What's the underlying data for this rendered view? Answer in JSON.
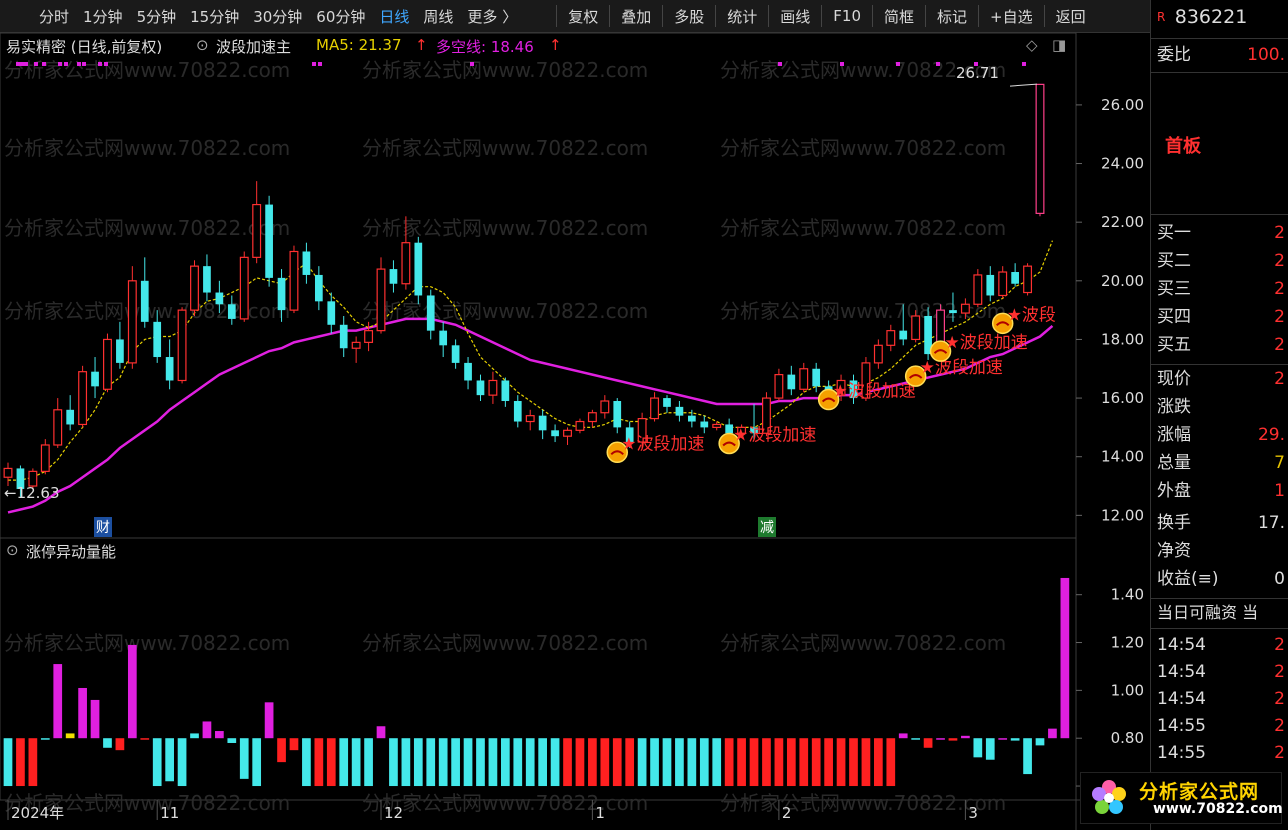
{
  "toolbar": {
    "periods": [
      "分时",
      "1分钟",
      "5分钟",
      "15分钟",
      "30分钟",
      "60分钟",
      "日线",
      "周线",
      "更多 〉"
    ],
    "active": "日线",
    "tools": [
      "复权",
      "叠加",
      "多股",
      "统计",
      "画线",
      "F10",
      "简框",
      "标记",
      "+自选",
      "返回"
    ]
  },
  "main_legend": {
    "stock": "易实精密 (日线,前复权)",
    "indicator": "波段加速主",
    "ma5_label": "MA5: 21.37",
    "ma5_arrow": "↑",
    "dk_label": "多空线: 18.46",
    "dk_arrow": "↑"
  },
  "watermark": "分析家公式网www.70822.com",
  "sub_legend": "涨停异动量能",
  "annotations": {
    "high_label": "26.71",
    "low_label": "←12.63",
    "signal_text": "★波段加速",
    "signal_text_cut": "★波段",
    "cai": "财",
    "jian": "减"
  },
  "colors": {
    "up": "#ff3030",
    "down": "#44e8ea",
    "ma5": "#e6d000",
    "dk": "#e020e0",
    "vol_pos": "#e020e0",
    "vol_neg_red": "#ff2020",
    "vol_neg_cyan": "#44e8ea",
    "vol_yellow": "#f0e000"
  },
  "right_panel": {
    "code": "836221",
    "code_tag": "R",
    "weibi": "委比",
    "weibi_val": "100.",
    "first_board": "首板",
    "bids": [
      {
        "label": "买一",
        "val": "2"
      },
      {
        "label": "买二",
        "val": "2"
      },
      {
        "label": "买三",
        "val": "2"
      },
      {
        "label": "买四",
        "val": "2"
      },
      {
        "label": "买五",
        "val": "2"
      }
    ],
    "stats": [
      {
        "label": "现价",
        "val": "2",
        "cls": ""
      },
      {
        "label": "涨跌",
        "val": "",
        "cls": ""
      },
      {
        "label": "涨幅",
        "val": "29.",
        "cls": ""
      },
      {
        "label": "总量",
        "val": "7",
        "cls": "y"
      },
      {
        "label": "外盘",
        "val": "1",
        "cls": ""
      },
      {
        "label": "换手",
        "val": "17.",
        "cls": "w"
      },
      {
        "label": "净资",
        "val": "",
        "cls": ""
      },
      {
        "label": "收益(≡)",
        "val": "0",
        "cls": "w"
      }
    ],
    "margin_title": "当日可融资 当",
    "ticks": [
      {
        "t": "14:54",
        "v": "2"
      },
      {
        "t": "14:54",
        "v": "2"
      },
      {
        "t": "14:54",
        "v": "2"
      },
      {
        "t": "14:55",
        "v": "2"
      },
      {
        "t": "14:55",
        "v": "2"
      }
    ]
  },
  "logo": {
    "name": "分析家公式网",
    "url": "www.70822.com"
  },
  "chart_data": [
    {
      "type": "candlestick",
      "title": "易实精密 (日线,前复权)",
      "y_ticks": [
        12.0,
        14.0,
        16.0,
        18.0,
        20.0,
        22.0,
        24.0,
        26.0
      ],
      "ylim": [
        11.5,
        27.6
      ],
      "x_labels": [
        {
          "label": "2024年",
          "index": 0
        },
        {
          "label": "11",
          "index": 12
        },
        {
          "label": "12",
          "index": 30
        },
        {
          "label": "1",
          "index": 47
        },
        {
          "label": "2",
          "index": 62
        },
        {
          "label": "3",
          "index": 77
        }
      ],
      "candles": [
        [
          13.3,
          13.8,
          13.0,
          13.6
        ],
        [
          13.6,
          13.7,
          12.63,
          12.9
        ],
        [
          13.0,
          13.6,
          12.9,
          13.5
        ],
        [
          13.5,
          14.6,
          13.4,
          14.4
        ],
        [
          14.4,
          16.0,
          14.3,
          15.6
        ],
        [
          15.6,
          16.1,
          14.9,
          15.1
        ],
        [
          15.1,
          17.1,
          15.0,
          16.9
        ],
        [
          16.9,
          17.4,
          16.0,
          16.4
        ],
        [
          16.3,
          18.2,
          16.2,
          18.0
        ],
        [
          18.0,
          18.6,
          17.0,
          17.2
        ],
        [
          17.2,
          20.5,
          17.0,
          20.0
        ],
        [
          20.0,
          20.8,
          18.4,
          18.6
        ],
        [
          18.6,
          19.0,
          17.2,
          17.4
        ],
        [
          17.4,
          18.0,
          16.3,
          16.6
        ],
        [
          16.6,
          19.1,
          16.5,
          19.0
        ],
        [
          19.0,
          20.7,
          18.8,
          20.5
        ],
        [
          20.5,
          20.9,
          19.3,
          19.6
        ],
        [
          19.6,
          20.0,
          18.9,
          19.2
        ],
        [
          19.2,
          19.5,
          18.5,
          18.7
        ],
        [
          18.7,
          21.0,
          18.6,
          20.8
        ],
        [
          20.8,
          23.4,
          20.6,
          22.6
        ],
        [
          22.6,
          22.9,
          19.8,
          20.1
        ],
        [
          20.1,
          20.4,
          18.6,
          19.0
        ],
        [
          19.0,
          21.2,
          18.9,
          21.0
        ],
        [
          21.0,
          21.3,
          19.9,
          20.2
        ],
        [
          20.2,
          20.5,
          19.0,
          19.3
        ],
        [
          19.3,
          19.6,
          18.2,
          18.5
        ],
        [
          18.5,
          18.8,
          17.4,
          17.7
        ],
        [
          17.7,
          18.1,
          17.2,
          17.9
        ],
        [
          17.9,
          18.6,
          17.6,
          18.3
        ],
        [
          18.3,
          20.8,
          18.2,
          20.4
        ],
        [
          20.4,
          20.7,
          19.6,
          19.9
        ],
        [
          19.9,
          22.2,
          19.7,
          21.3
        ],
        [
          21.3,
          21.5,
          19.2,
          19.5
        ],
        [
          19.5,
          19.7,
          18.0,
          18.3
        ],
        [
          18.3,
          18.6,
          17.4,
          17.8
        ],
        [
          17.8,
          18.0,
          17.0,
          17.2
        ],
        [
          17.2,
          17.4,
          16.3,
          16.6
        ],
        [
          16.6,
          16.8,
          15.9,
          16.1
        ],
        [
          16.1,
          16.9,
          15.8,
          16.6
        ],
        [
          16.6,
          16.7,
          15.7,
          15.9
        ],
        [
          15.9,
          16.1,
          15.0,
          15.2
        ],
        [
          15.2,
          15.6,
          14.9,
          15.4
        ],
        [
          15.4,
          15.6,
          14.6,
          14.9
        ],
        [
          14.9,
          15.1,
          14.5,
          14.7
        ],
        [
          14.7,
          15.0,
          14.4,
          14.9
        ],
        [
          14.9,
          15.3,
          14.8,
          15.2
        ],
        [
          15.2,
          15.6,
          15.0,
          15.5
        ],
        [
          15.5,
          16.1,
          15.3,
          15.9
        ],
        [
          15.9,
          16.0,
          14.8,
          15.0
        ],
        [
          15.0,
          15.2,
          14.3,
          14.5
        ],
        [
          14.5,
          15.5,
          14.3,
          15.3
        ],
        [
          15.3,
          16.2,
          15.2,
          16.0
        ],
        [
          16.0,
          16.1,
          15.5,
          15.7
        ],
        [
          15.7,
          15.9,
          15.2,
          15.4
        ],
        [
          15.4,
          15.6,
          15.0,
          15.2
        ],
        [
          15.2,
          15.4,
          14.8,
          15.0
        ],
        [
          15.0,
          15.2,
          14.9,
          15.1
        ],
        [
          15.1,
          15.3,
          14.7,
          14.8
        ],
        [
          14.8,
          15.1,
          14.7,
          15.0
        ],
        [
          15.0,
          15.8,
          14.6,
          14.8
        ],
        [
          14.8,
          16.2,
          14.7,
          16.0
        ],
        [
          16.0,
          17.0,
          15.9,
          16.8
        ],
        [
          16.8,
          17.1,
          16.1,
          16.3
        ],
        [
          16.3,
          17.2,
          16.2,
          17.0
        ],
        [
          17.0,
          17.2,
          16.2,
          16.4
        ],
        [
          16.4,
          16.6,
          15.9,
          16.1
        ],
        [
          16.1,
          16.8,
          15.9,
          16.6
        ],
        [
          16.6,
          16.8,
          15.8,
          16.0
        ],
        [
          16.0,
          17.4,
          15.9,
          17.2
        ],
        [
          17.2,
          18.0,
          17.0,
          17.8
        ],
        [
          17.8,
          18.5,
          17.6,
          18.3
        ],
        [
          18.3,
          19.2,
          17.8,
          18.0
        ],
        [
          18.0,
          19.0,
          17.9,
          18.8
        ],
        [
          18.8,
          19.1,
          17.3,
          17.5
        ],
        [
          17.5,
          19.2,
          17.4,
          19.0
        ],
        [
          19.0,
          19.6,
          18.6,
          18.9
        ],
        [
          18.9,
          19.4,
          18.7,
          19.2
        ],
        [
          19.2,
          20.4,
          19.1,
          20.2
        ],
        [
          20.2,
          20.5,
          19.3,
          19.5
        ],
        [
          19.5,
          20.5,
          19.4,
          20.3
        ],
        [
          20.3,
          20.6,
          19.8,
          19.9
        ],
        [
          19.6,
          20.6,
          19.5,
          20.5
        ],
        [
          22.3,
          26.71,
          22.2,
          26.7
        ]
      ],
      "ma5": [
        13.2,
        13.2,
        13.3,
        13.5,
        13.9,
        14.5,
        15.0,
        15.6,
        16.4,
        16.7,
        17.6,
        18.0,
        18.1,
        18.1,
        18.3,
        18.9,
        19.3,
        19.4,
        19.6,
        19.8,
        20.1,
        20.0,
        19.9,
        20.3,
        20.6,
        20.0,
        19.5,
        19.1,
        18.6,
        18.4,
        18.6,
        19.0,
        19.4,
        19.8,
        19.8,
        19.6,
        19.1,
        18.2,
        17.4,
        17.0,
        16.6,
        16.2,
        15.9,
        15.6,
        15.3,
        15.1,
        15.0,
        15.0,
        15.1,
        15.3,
        15.2,
        15.2,
        15.4,
        15.5,
        15.5,
        15.5,
        15.4,
        15.2,
        15.0,
        15.0,
        15.0,
        15.2,
        15.5,
        15.8,
        16.2,
        16.4,
        16.4,
        16.5,
        16.4,
        16.5,
        16.7,
        17.0,
        17.4,
        17.8,
        18.0,
        18.2,
        18.4,
        18.6,
        18.9,
        19.2,
        19.4,
        19.8,
        20.0,
        20.3,
        21.37
      ],
      "duokong": [
        12.1,
        12.2,
        12.3,
        12.5,
        12.8,
        13.0,
        13.3,
        13.6,
        13.9,
        14.3,
        14.6,
        14.9,
        15.2,
        15.6,
        15.9,
        16.2,
        16.5,
        16.8,
        17.0,
        17.2,
        17.4,
        17.6,
        17.7,
        17.9,
        18.0,
        18.1,
        18.2,
        18.3,
        18.3,
        18.4,
        18.5,
        18.6,
        18.7,
        18.7,
        18.7,
        18.6,
        18.5,
        18.3,
        18.1,
        17.9,
        17.7,
        17.5,
        17.3,
        17.2,
        17.1,
        17.0,
        16.9,
        16.8,
        16.7,
        16.6,
        16.5,
        16.4,
        16.3,
        16.2,
        16.1,
        16.0,
        15.9,
        15.8,
        15.8,
        15.8,
        15.8,
        15.8,
        15.9,
        15.9,
        16.0,
        16.0,
        16.0,
        16.1,
        16.1,
        16.2,
        16.3,
        16.4,
        16.5,
        16.6,
        16.7,
        16.8,
        16.9,
        17.0,
        17.2,
        17.4,
        17.5,
        17.7,
        17.9,
        18.1,
        18.46
      ],
      "signals": [
        {
          "index": 49,
          "y": 14.15
        },
        {
          "index": 58,
          "y": 14.45
        },
        {
          "index": 66,
          "y": 15.95
        },
        {
          "index": 73,
          "y": 16.75
        },
        {
          "index": 75,
          "y": 17.6
        },
        {
          "index": 80,
          "y": 18.55
        }
      ]
    },
    {
      "type": "bar",
      "title": "涨停异动量能",
      "y_ticks": [
        0.6,
        0.8,
        1.0,
        1.2,
        1.4
      ],
      "ylim": [
        0.55,
        1.52
      ],
      "baseline": 0.8,
      "values": [
        0.6,
        0.6,
        0.6,
        0.8,
        1.11,
        0.82,
        1.01,
        0.96,
        0.76,
        0.75,
        1.19,
        0.8,
        0.6,
        0.62,
        0.6,
        0.82,
        0.87,
        0.83,
        0.78,
        0.63,
        0.6,
        0.95,
        0.7,
        0.75,
        0.6,
        0.6,
        0.6,
        0.6,
        0.6,
        0.6,
        0.85,
        0.6,
        0.6,
        0.6,
        0.6,
        0.6,
        0.6,
        0.6,
        0.6,
        0.6,
        0.6,
        0.6,
        0.6,
        0.6,
        0.6,
        0.6,
        0.6,
        0.6,
        0.6,
        0.6,
        0.6,
        0.6,
        0.6,
        0.6,
        0.6,
        0.6,
        0.6,
        0.6,
        0.6,
        0.6,
        0.6,
        0.6,
        0.6,
        0.6,
        0.6,
        0.6,
        0.6,
        0.6,
        0.6,
        0.6,
        0.6,
        0.6,
        0.82,
        0.8,
        0.76,
        0.8,
        0.79,
        0.81,
        0.72,
        0.71,
        0.8,
        0.79,
        0.65,
        0.77,
        0.84,
        1.47
      ],
      "colors": [
        "c",
        "r",
        "r",
        "c",
        "m",
        "y",
        "m",
        "m",
        "c",
        "r",
        "m",
        "r",
        "c",
        "c",
        "c",
        "c",
        "m",
        "m",
        "c",
        "c",
        "c",
        "m",
        "r",
        "r",
        "c",
        "r",
        "r",
        "c",
        "c",
        "c",
        "m",
        "c",
        "c",
        "c",
        "c",
        "c",
        "c",
        "c",
        "c",
        "c",
        "c",
        "c",
        "c",
        "c",
        "c",
        "r",
        "r",
        "r",
        "r",
        "r",
        "r",
        "c",
        "c",
        "c",
        "c",
        "c",
        "c",
        "c",
        "r",
        "r",
        "r",
        "r",
        "r",
        "r",
        "r",
        "r",
        "r",
        "r",
        "r",
        "r",
        "r",
        "r",
        "m",
        "c",
        "r",
        "m",
        "r",
        "m",
        "c",
        "c",
        "m",
        "c",
        "c",
        "c",
        "m",
        "m"
      ]
    }
  ]
}
